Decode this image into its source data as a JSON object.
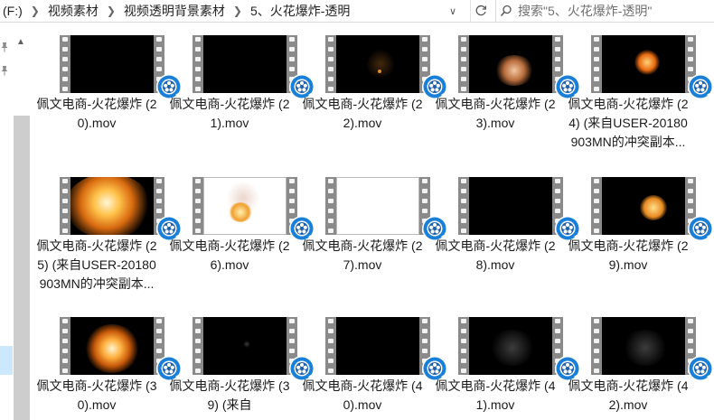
{
  "address": {
    "crumbs": [
      "(F:)",
      "视频素材",
      "视频透明背景素材",
      "5、火花爆炸-透明"
    ]
  },
  "search": {
    "placeholder": "搜索\"5、火花爆炸-透明\""
  },
  "files": [
    {
      "label": "佩文电商-火花爆炸 (20).mov"
    },
    {
      "label": "佩文电商-火花爆炸 (21).mov"
    },
    {
      "label": "佩文电商-火花爆炸 (22).mov"
    },
    {
      "label": "佩文电商-火花爆炸 (23).mov"
    },
    {
      "label": "佩文电商-火花爆炸 (24) (来自USER-20180903MN的冲突副本..."
    },
    {
      "label": "佩文电商-火花爆炸 (25) (来自USER-20180903MN的冲突副本..."
    },
    {
      "label": "佩文电商-火花爆炸 (26).mov"
    },
    {
      "label": "佩文电商-火花爆炸 (27).mov"
    },
    {
      "label": "佩文电商-火花爆炸 (28).mov"
    },
    {
      "label": "佩文电商-火花爆炸 (29).mov"
    },
    {
      "label": "佩文电商-火花爆炸 (30).mov"
    },
    {
      "label": "佩文电商-火花爆炸 (39) (来自"
    },
    {
      "label": "佩文电商-火花爆炸 (40).mov"
    },
    {
      "label": "佩文电商-火花爆炸 (41).mov"
    },
    {
      "label": "佩文电商-火花爆炸 (42).mov"
    }
  ],
  "icons": {
    "quicktime": "quicktime-badge-icon",
    "pin": "pin-icon",
    "search": "search-icon",
    "refresh": "refresh-icon",
    "chevron": "chevron-down-icon"
  },
  "colors": {
    "quicktime_blue": "#1a7fd6",
    "selection": "#cce8ff"
  }
}
